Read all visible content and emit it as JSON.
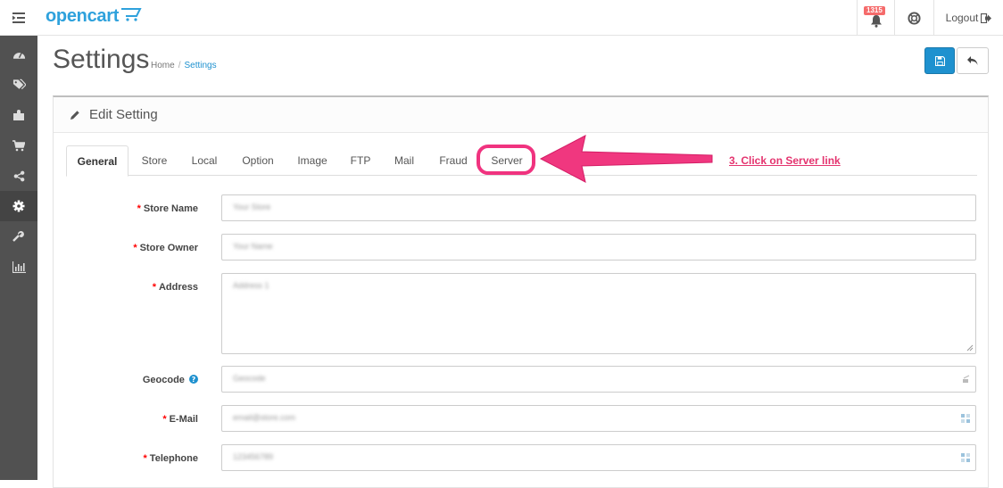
{
  "header": {
    "logo_text": "opencart",
    "notification_count": "1315",
    "logout_label": "Logout"
  },
  "sidebar": {
    "items": [
      "dashboard-icon",
      "tags-icon",
      "puzzle-icon",
      "cart-icon",
      "share-icon",
      "gear-icon",
      "wrench-icon",
      "bar-chart-icon"
    ],
    "active_index": 5
  },
  "page": {
    "title": "Settings",
    "breadcrumb": [
      "Home",
      "Settings"
    ]
  },
  "panel": {
    "heading": "Edit Setting",
    "tabs": [
      "General",
      "Store",
      "Local",
      "Option",
      "Image",
      "FTP",
      "Mail",
      "Fraud",
      "Server"
    ],
    "active_tab": "General"
  },
  "annotation": {
    "text": "3. Click on Server link",
    "color": "#e4346f"
  },
  "form": {
    "fields": [
      {
        "label": "Store Name",
        "required": true,
        "value": "Your Store"
      },
      {
        "label": "Store Owner",
        "required": true,
        "value": "Your Name"
      },
      {
        "label": "Address",
        "required": true,
        "value": "Address 1"
      },
      {
        "label": "Geocode",
        "required": false,
        "value": "Geocode"
      },
      {
        "label": "E-Mail",
        "required": true,
        "value": "email@store.com"
      },
      {
        "label": "Telephone",
        "required": true,
        "value": "123456789"
      }
    ]
  },
  "colors": {
    "primary": "#1e91cf",
    "sidebar": "#515151",
    "required": "#ff0000",
    "highlight": "#f0337f"
  }
}
